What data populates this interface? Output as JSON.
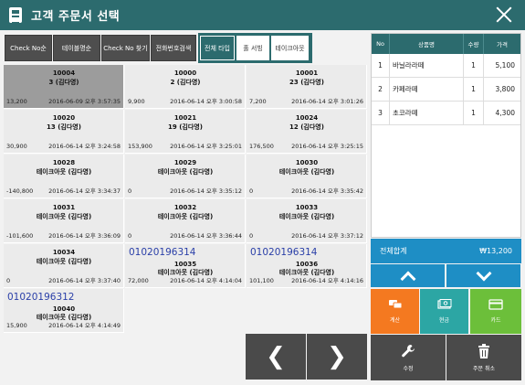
{
  "window": {
    "title": "고객 주문서 선택"
  },
  "top_buttons": [
    "Check No순",
    "테이블명순",
    "Check No 찾기",
    "전화번호검색"
  ],
  "filter_tabs": [
    {
      "label": "전체 타입",
      "active": true
    },
    {
      "label": "홀 서빙",
      "active": false
    },
    {
      "label": "테이크아웃",
      "active": false
    }
  ],
  "orders": [
    {
      "check_no": "10004",
      "name": "3 (김다영)",
      "amount": "13,200",
      "datetime": "2016-06-09 오후 3:57:35",
      "phone": "",
      "selected": true
    },
    {
      "check_no": "10000",
      "name": "2 (김다영)",
      "amount": "9,900",
      "datetime": "2016-06-14 오후 3:00:58",
      "phone": "",
      "selected": false
    },
    {
      "check_no": "10001",
      "name": "23 (김다영)",
      "amount": "7,200",
      "datetime": "2016-06-14 오후 3:01:26",
      "phone": "",
      "selected": false
    },
    {
      "check_no": "10020",
      "name": "13 (김다영)",
      "amount": "30,900",
      "datetime": "2016-06-14 오후 3:24:58",
      "phone": "",
      "selected": false
    },
    {
      "check_no": "10021",
      "name": "19 (김다영)",
      "amount": "153,900",
      "datetime": "2016-06-14 오후 3:25:01",
      "phone": "",
      "selected": false
    },
    {
      "check_no": "10024",
      "name": "12 (김다영)",
      "amount": "176,500",
      "datetime": "2016-06-14 오후 3:25:15",
      "phone": "",
      "selected": false
    },
    {
      "check_no": "10028",
      "name": "테이크아웃 (김다영)",
      "amount": "-140,800",
      "datetime": "2016-06-14 오후 3:34:37",
      "phone": "",
      "selected": false
    },
    {
      "check_no": "10029",
      "name": "테이크아웃 (김다영)",
      "amount": "0",
      "datetime": "2016-06-14 오후 3:35:12",
      "phone": "",
      "selected": false
    },
    {
      "check_no": "10030",
      "name": "테이크아웃 (김다영)",
      "amount": "0",
      "datetime": "2016-06-14 오후 3:35:42",
      "phone": "",
      "selected": false
    },
    {
      "check_no": "10031",
      "name": "테이크아웃 (김다영)",
      "amount": "-101,600",
      "datetime": "2016-06-14 오후 3:36:09",
      "phone": "",
      "selected": false
    },
    {
      "check_no": "10032",
      "name": "테이크아웃 (김다영)",
      "amount": "0",
      "datetime": "2016-06-14 오후 3:36:44",
      "phone": "",
      "selected": false
    },
    {
      "check_no": "10033",
      "name": "테이크아웃 (김다영)",
      "amount": "0",
      "datetime": "2016-06-14 오후 3:37:12",
      "phone": "",
      "selected": false
    },
    {
      "check_no": "10034",
      "name": "테이크아웃 (김다영)",
      "amount": "0",
      "datetime": "2016-06-14 오후 3:37:40",
      "phone": "",
      "selected": false
    },
    {
      "check_no": "10035",
      "name": "테이크아웃 (김다영)",
      "amount": "72,000",
      "datetime": "2016-06-14 오후 4:14:04",
      "phone": "01020196314",
      "selected": false
    },
    {
      "check_no": "10036",
      "name": "테이크아웃 (김다영)",
      "amount": "101,100",
      "datetime": "2016-06-14 오후 4:14:16",
      "phone": "01020196314",
      "selected": false
    },
    {
      "check_no": "10040",
      "name": "테이크아웃 (김다영)",
      "amount": "15,900",
      "datetime": "2016-06-14 오후 4:14:49",
      "phone": "01020196312",
      "selected": false
    }
  ],
  "order_table": {
    "headers": [
      "No",
      "상품명",
      "수량",
      "가격"
    ],
    "rows": [
      {
        "no": "1",
        "item": "바닐라라떼",
        "qty": "1",
        "price": "5,100"
      },
      {
        "no": "2",
        "item": "카페라떼",
        "qty": "1",
        "price": "3,800"
      },
      {
        "no": "3",
        "item": "초코라떼",
        "qty": "1",
        "price": "4,300"
      }
    ]
  },
  "total": {
    "label": "전체합계",
    "value": "₩13,200"
  },
  "actions": {
    "calc": "계산",
    "cash": "현금",
    "card": "카드",
    "edit": "수정",
    "cancel": "주문 취소"
  },
  "colors": {
    "titlebar": "#2c6b6e",
    "blue": "#1e8ec5",
    "orange": "#f47920",
    "teal": "#2ca6a4",
    "green": "#6cbf3a",
    "dark": "#4a4a4a",
    "selected_card": "#9c9c9c"
  }
}
